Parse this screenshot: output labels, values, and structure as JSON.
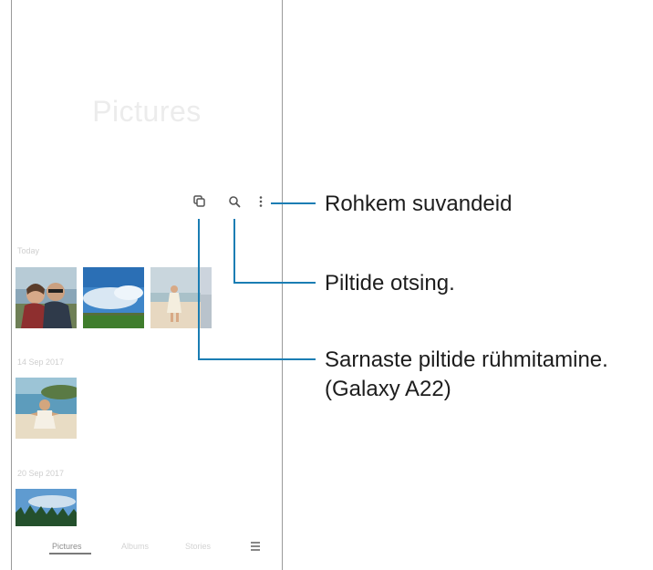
{
  "app": {
    "title": "Pictures"
  },
  "toolbar": {
    "group_icon": "group-similar-icon",
    "search_icon": "search-icon",
    "more_icon": "more-options-icon"
  },
  "sections": [
    {
      "label": "Today",
      "thumbs": [
        "couple-selfie",
        "sky-field",
        "beach-girl",
        "partial"
      ]
    },
    {
      "label": "14 Sep 2017",
      "thumbs": [
        "child-beach"
      ]
    },
    {
      "label": "20 Sep 2017",
      "thumbs": [
        "forest-sky"
      ]
    }
  ],
  "bottom_nav": {
    "tabs": [
      "Pictures",
      "Albums",
      "Stories"
    ],
    "active_tab": "Pictures",
    "menu_icon": "menu-icon"
  },
  "callouts": {
    "more_options": "Rohkem suvandeid",
    "search": "Piltide otsing.",
    "group_similar_line1": "Sarnaste piltide rühmitamine.",
    "group_similar_line2": "(Galaxy A22)"
  },
  "colors": {
    "leader_line": "#1a7db3",
    "callout_text": "#1d1d1d"
  }
}
